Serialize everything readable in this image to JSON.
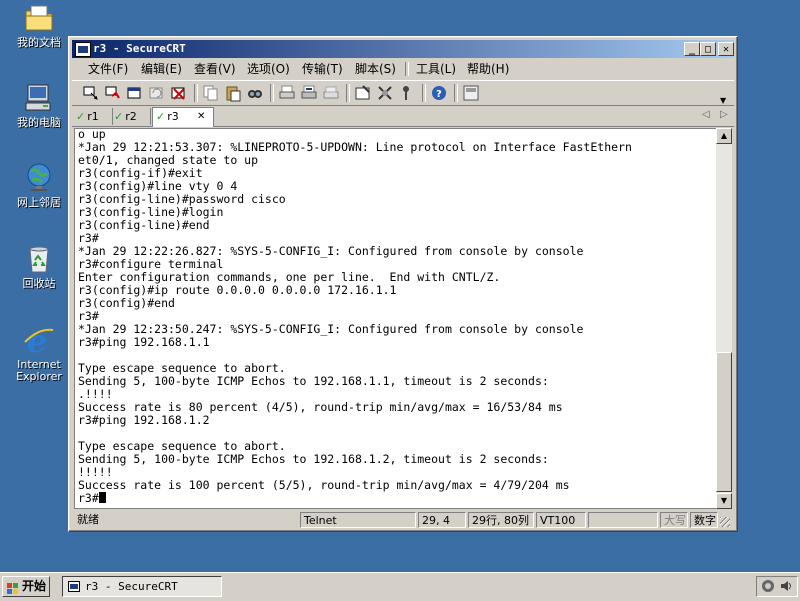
{
  "desktop": {
    "icons": [
      {
        "label": "我的文档"
      },
      {
        "label": "我的电脑"
      },
      {
        "label": "网上邻居"
      },
      {
        "label": "回收站"
      },
      {
        "label": "Internet Explorer"
      }
    ]
  },
  "window": {
    "title": "r3 - SecureCRT",
    "controls": {
      "minimize": "_",
      "maximize": "□",
      "close": "✕"
    }
  },
  "menu": [
    {
      "label": "文件(F)"
    },
    {
      "label": "编辑(E)"
    },
    {
      "label": "查看(V)"
    },
    {
      "label": "选项(O)"
    },
    {
      "label": "传输(T)"
    },
    {
      "label": "脚本(S)"
    },
    {
      "label": "工具(L)"
    },
    {
      "label": "帮助(H)"
    }
  ],
  "tabs": [
    {
      "label": "r1",
      "active": false
    },
    {
      "label": "r2",
      "active": false
    },
    {
      "label": "r3",
      "active": true,
      "close": "✕"
    }
  ],
  "terminal": {
    "lines": [
      "o up",
      "*Jan 29 12:21:53.307: %LINEPROTO-5-UPDOWN: Line protocol on Interface FastEthern",
      "et0/1, changed state to up",
      "r3(config-if)#exit",
      "r3(config)#line vty 0 4",
      "r3(config-line)#password cisco",
      "r3(config-line)#login",
      "r3(config-line)#end",
      "r3#",
      "*Jan 29 12:22:26.827: %SYS-5-CONFIG_I: Configured from console by console",
      "r3#configure terminal",
      "Enter configuration commands, one per line.  End with CNTL/Z.",
      "r3(config)#ip route 0.0.0.0 0.0.0.0 172.16.1.1",
      "r3(config)#end",
      "r3#",
      "*Jan 29 12:23:50.247: %SYS-5-CONFIG_I: Configured from console by console",
      "r3#ping 192.168.1.1",
      "",
      "Type escape sequence to abort.",
      "Sending 5, 100-byte ICMP Echos to 192.168.1.1, timeout is 2 seconds:",
      ".!!!!",
      "Success rate is 80 percent (4/5), round-trip min/avg/max = 16/53/84 ms",
      "r3#ping 192.168.1.2",
      "",
      "Type escape sequence to abort.",
      "Sending 5, 100-byte ICMP Echos to 192.168.1.2, timeout is 2 seconds:",
      "!!!!!",
      "Success rate is 100 percent (5/5), round-trip min/avg/max = 4/79/204 ms",
      "r3#"
    ]
  },
  "status": {
    "ready": "就绪",
    "protocol": "Telnet",
    "cursor_pos": "29,  4",
    "size": "29行, 80列",
    "emulation": "VT100",
    "caps": "大写",
    "num": "数字"
  },
  "taskbar": {
    "start_label": "开始",
    "task_label": "r3 - SecureCRT"
  },
  "colors": {
    "desktop": "#3a6ea5",
    "titlebar_start": "#0a246a",
    "titlebar_end": "#a6caf0",
    "face": "#d4d0c8"
  }
}
